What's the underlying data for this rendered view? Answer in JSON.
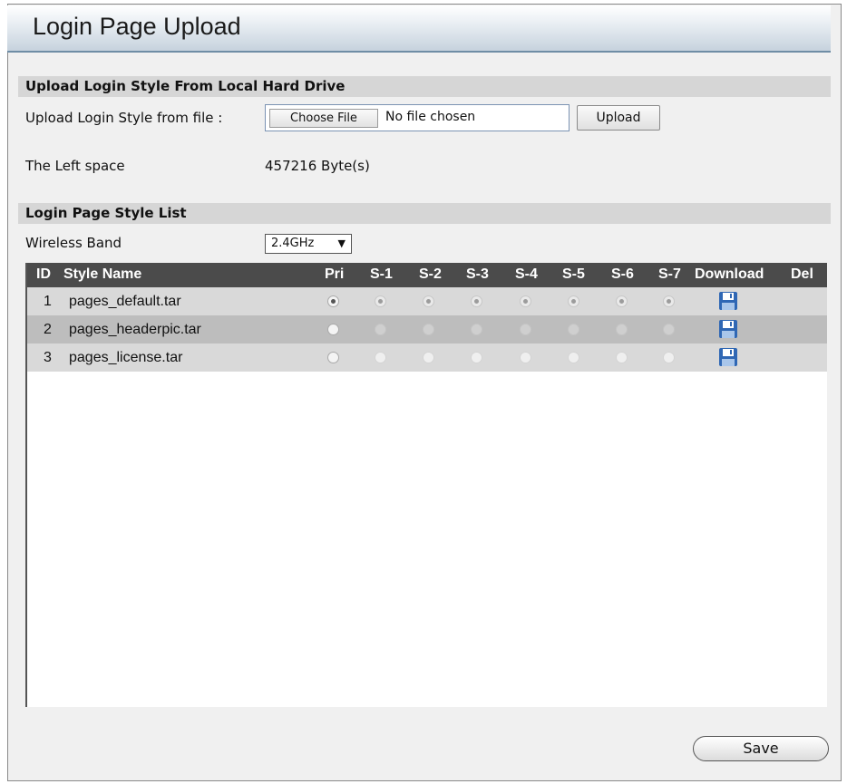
{
  "title": "Login Page Upload",
  "upload_section": {
    "heading": "Upload Login Style From Local Hard Drive",
    "file_label": "Upload Login Style from file :",
    "choose_file_label": "Choose File",
    "no_file_text": "No file chosen",
    "upload_button": "Upload",
    "left_space_label": "The Left space",
    "left_space_value": "457216 Byte(s)"
  },
  "style_list_section": {
    "heading": "Login Page Style List",
    "wireless_band_label": "Wireless Band",
    "wireless_band_value": "2.4GHz"
  },
  "table": {
    "columns": [
      "ID",
      "Style Name",
      "Pri",
      "S-1",
      "S-2",
      "S-3",
      "S-4",
      "S-5",
      "S-6",
      "S-7",
      "Download",
      "Del"
    ],
    "rows": [
      {
        "id": "1",
        "name": "pages_default.tar",
        "pri_selected": true,
        "ssid_selected": [
          true,
          true,
          true,
          true,
          true,
          true,
          true
        ]
      },
      {
        "id": "2",
        "name": "pages_headerpic.tar",
        "pri_selected": false,
        "ssid_selected": [
          false,
          false,
          false,
          false,
          false,
          false,
          false
        ]
      },
      {
        "id": "3",
        "name": "pages_license.tar",
        "pri_selected": false,
        "ssid_selected": [
          false,
          false,
          false,
          false,
          false,
          false,
          false
        ]
      }
    ],
    "download_icon": "floppy-disk-icon"
  },
  "save_button": "Save"
}
